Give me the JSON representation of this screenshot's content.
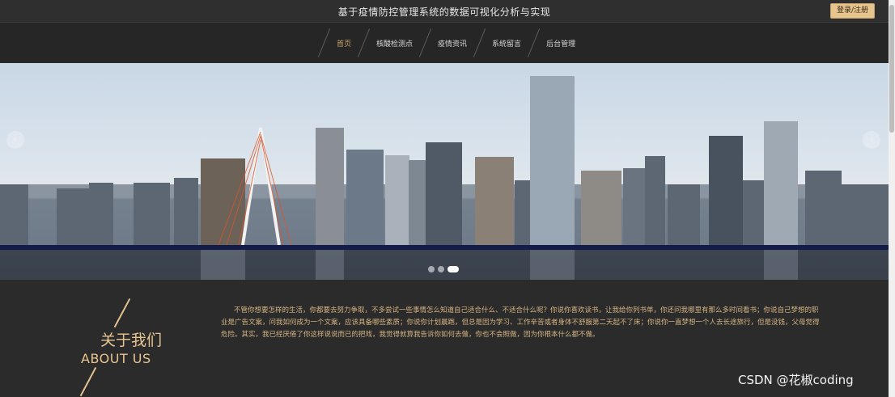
{
  "header": {
    "title": "基于疫情防控管理系统的数据可视化分析与实现",
    "login_label": "登录/注册"
  },
  "nav": {
    "items": [
      {
        "label": "首页",
        "active": true
      },
      {
        "label": "核酸检测点",
        "active": false
      },
      {
        "label": "疫情资讯",
        "active": false
      },
      {
        "label": "系统留言",
        "active": false
      },
      {
        "label": "后台管理",
        "active": false
      }
    ]
  },
  "banner": {
    "prev_icon": "chevron-left-icon",
    "next_icon": "chevron-right-icon",
    "slides": 3,
    "active_slide": 3,
    "prev_glyph": "‹",
    "next_glyph": "›"
  },
  "about": {
    "title_cn": "关于我们",
    "title_en": "ABOUT US",
    "text": "不管你想要怎样的生活，你都要去努力争取，不多尝试一些事情怎么知道自己适合什么、不适合什么呢？你说你喜欢读书，让我给你列书单，你还问我哪里有那么多时间看书；你说自己梦想的职业是广告文案，问我如何成为一个文案，应该具备哪些素质；你说你计划晨跑，但总是因为学习、工作辛苦或者身体不舒服第二天起不了床；你说你一直梦想一个人去长途旅行，但是没钱，父母觉得危险。其实，我已经厌倦了你这样说说而已的把戏，我觉得就算我告诉你如何去做，你也不会照做，因为你根本什么都不做。"
  },
  "watermark": "CSDN @花椒coding",
  "colors": {
    "accent": "#e7c58f",
    "active_nav": "#c9a36a",
    "background": "#2b2b2b"
  }
}
